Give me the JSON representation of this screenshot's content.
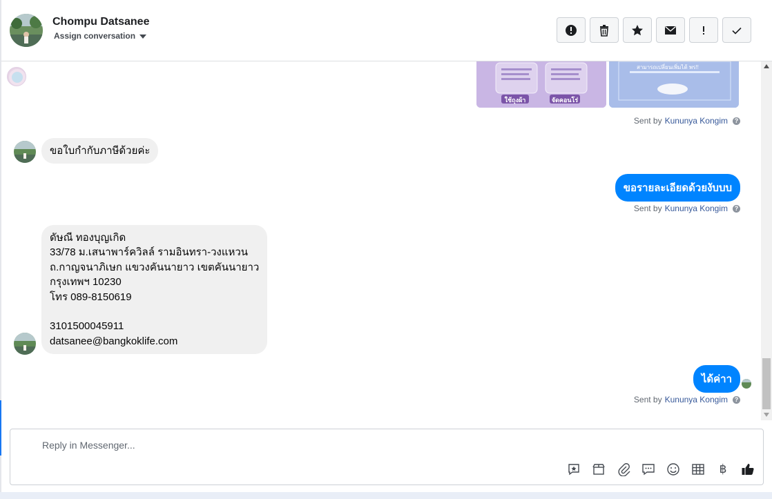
{
  "header": {
    "contact_name": "Chompu Datsanee",
    "assign_label": "Assign conversation"
  },
  "actions": [
    {
      "name": "mark-spam",
      "icon": "alert-circle-icon"
    },
    {
      "name": "delete",
      "icon": "trash-icon"
    },
    {
      "name": "star",
      "icon": "star-icon"
    },
    {
      "name": "mark-unread",
      "icon": "envelope-icon"
    },
    {
      "name": "follow-up",
      "icon": "exclamation-icon"
    },
    {
      "name": "mark-done",
      "icon": "checkmark-icon"
    }
  ],
  "messages": {
    "image_card_1_labels": [
      "ใช้ถุงผ้า",
      "จัดคอนโร่"
    ],
    "image_card_2_text": "สามารถเปลี่ยนเพิ่มได้ พร!!",
    "sent_by_prefix": "Sent by",
    "agent_name": "Kununya Kongim",
    "incoming_1": "ขอใบกำกับภาษีด้วยค่ะ",
    "outgoing_1": "ขอรายละเอียดด้วยงับบบ",
    "incoming_2": "ดัษณี ทองบุญเกิด\n33/78 ม.เสนาพาร์ควิลล์ รามอินทรา-วงแหวน\nถ.กาญจนาภิเษก แขวงคันนายาว เขตคันนายาว\nกรุงเทพฯ 10230\nโทร 089-8150619\n\n3101500045911\ndatsanee@bangkoklife.com",
    "outgoing_2": "ได้ค่าา"
  },
  "reply": {
    "placeholder": "Reply in Messenger..."
  },
  "toolbar_icons": [
    "saved-reply-icon",
    "shop-icon",
    "attachment-icon",
    "quick-reply-icon",
    "emoji-icon",
    "table-icon",
    "baht-icon",
    "like-icon"
  ],
  "toolbar_baht_glyph": "฿",
  "colors": {
    "outgoing_bubble": "#0084ff",
    "incoming_bubble": "#f0f0f0",
    "agent_link": "#365899"
  }
}
